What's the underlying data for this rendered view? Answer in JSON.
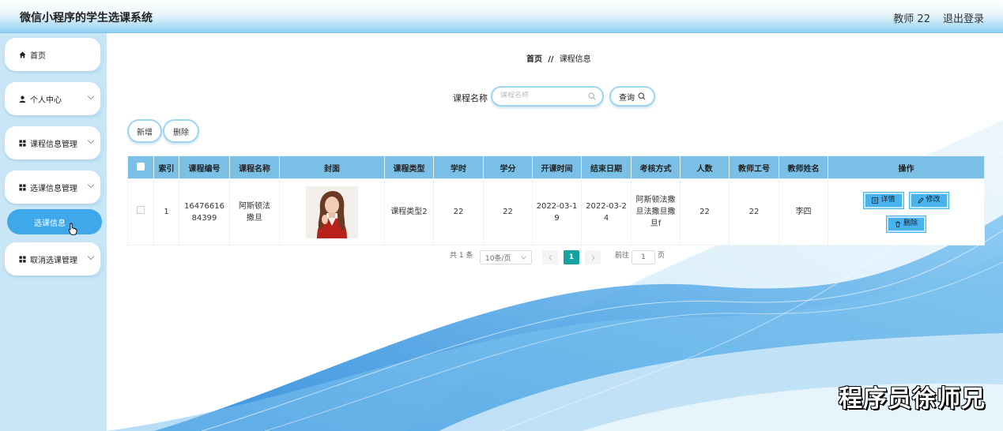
{
  "header": {
    "title": "微信小程序的学生选课系统",
    "user": "教师 22",
    "logout": "退出登录"
  },
  "sidebar": {
    "items": [
      {
        "label": "首页",
        "icon": "home-icon"
      },
      {
        "label": "个人中心",
        "icon": "user-icon"
      },
      {
        "label": "课程信息管理",
        "icon": "grid-icon"
      },
      {
        "label": "选课信息管理",
        "icon": "grid-icon"
      },
      {
        "label": "取消选课管理",
        "icon": "grid-icon"
      }
    ],
    "active_sub": "选课信息"
  },
  "breadcrumb": {
    "home": "首页",
    "sep": "//",
    "current": "课程信息"
  },
  "search": {
    "label": "课程名称",
    "placeholder": "课程名称",
    "value": "",
    "button": "查询"
  },
  "toolbar": {
    "add": "新增",
    "delete": "删除"
  },
  "table": {
    "headers": [
      "索引",
      "课程编号",
      "课程名称",
      "封面",
      "课程类型",
      "学时",
      "学分",
      "开课时间",
      "结束日期",
      "考核方式",
      "人数",
      "教师工号",
      "教师姓名",
      "操作"
    ],
    "rows": [
      {
        "index": "1",
        "course_no": "1647661684399",
        "course_name": "阿斯顿法撒旦",
        "course_type": "课程类型2",
        "hours": "22",
        "credits": "22",
        "start": "2022-03-19",
        "end": "2022-03-24",
        "assessment": "阿斯顿法撒旦法撒旦撒旦f",
        "people": "22",
        "teacher_no": "22",
        "teacher_name": "李四"
      }
    ],
    "actions": {
      "detail": "详情",
      "edit": "修改",
      "delete": "删除"
    }
  },
  "pagination": {
    "total": "共 1 条",
    "page_size": "10条/页",
    "current": "1",
    "goto_label": "前往",
    "goto_value": "1",
    "page_unit": "页"
  },
  "watermark": "程序员徐师兄",
  "colors": {
    "accent": "#3ea8ea",
    "table_header": "#79bfe6",
    "page_active": "#17a2a2",
    "sidebar_bg": "#c9e6f6"
  }
}
